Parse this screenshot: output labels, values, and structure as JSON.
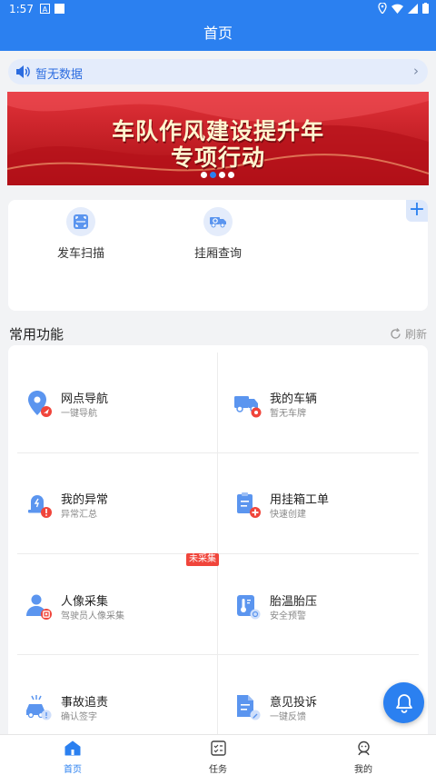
{
  "status_bar": {
    "time": "1:57"
  },
  "header": {
    "title": "首页"
  },
  "notice": {
    "text": "暂无数据",
    "chevron": "›"
  },
  "banner": {
    "line1": "车队作风建设提升年",
    "line2": "专项行动",
    "slide_count": 4,
    "active_slide": 2
  },
  "quick_actions": [
    {
      "label": "发车扫描",
      "icon": "scan-icon"
    },
    {
      "label": "挂厢查询",
      "icon": "truck-search-icon"
    }
  ],
  "add_button": "+",
  "section": {
    "title": "常用功能",
    "refresh_label": "刷新"
  },
  "functions": [
    {
      "title": "网点导航",
      "sub": "一键导航",
      "icon": "location-navigation-icon"
    },
    {
      "title": "我的车辆",
      "sub": "暂无车牌",
      "icon": "truck-settings-icon"
    },
    {
      "title": "我的异常",
      "sub": "异常汇总",
      "icon": "alarm-warning-icon"
    },
    {
      "title": "用挂箱工单",
      "sub": "快速创建",
      "icon": "clipboard-add-icon"
    },
    {
      "title": "人像采集",
      "sub": "驾驶员人像采集",
      "icon": "person-scan-icon"
    },
    {
      "title": "胎温胎压",
      "sub": "安全预警",
      "icon": "thermometer-icon"
    },
    {
      "title": "事故追责",
      "sub": "确认签字",
      "icon": "accident-car-icon"
    },
    {
      "title": "意见投诉",
      "sub": "一键反馈",
      "icon": "feedback-doc-icon"
    }
  ],
  "uncollected_tag": "未采集",
  "tabs": [
    {
      "label": "首页",
      "icon": "home-icon",
      "active": true
    },
    {
      "label": "任务",
      "icon": "task-icon",
      "active": false
    },
    {
      "label": "我的",
      "icon": "profile-icon",
      "active": false
    }
  ],
  "colors": {
    "primary": "#2b80f0",
    "warning": "#f0453b",
    "banner_red": "#c8141b"
  }
}
